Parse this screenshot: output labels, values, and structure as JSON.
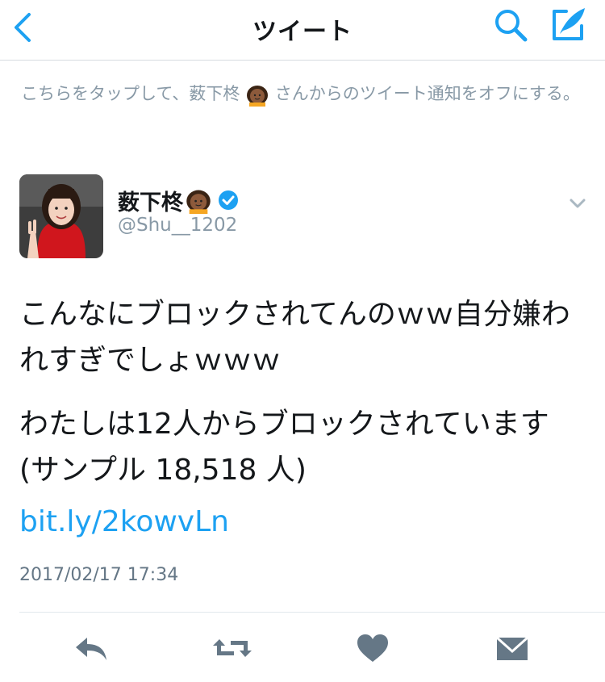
{
  "header": {
    "title": "ツイート",
    "back_icon": "chevron-left-icon",
    "search_icon": "search-icon",
    "compose_icon": "compose-quill-icon",
    "accent": "#1da1f2"
  },
  "notification_notice": {
    "prefix": "こちらをタップして、薮下柊",
    "suffix": "さんからのツイート通知をオフにする。",
    "emoji": "person-emoji-icon"
  },
  "tweet": {
    "author_name": "薮下柊",
    "author_emoji": "person-emoji-icon",
    "verified_icon": "verified-badge-icon",
    "handle": "@Shu__1202",
    "paragraph_1": "こんなにブロックされてんのｗｗ自分嫌われすぎでしょｗｗｗ",
    "paragraph_2": "わたしは12人からブロックされています(サンプル 18,518 人)",
    "link": "bit.ly/2kowvLn",
    "timestamp": "2017/02/17 17:34"
  },
  "actions": {
    "reply_icon": "reply-icon",
    "retweet_icon": "retweet-icon",
    "like_icon": "heart-icon",
    "dm_icon": "envelope-icon",
    "icon_color": "#657786"
  }
}
